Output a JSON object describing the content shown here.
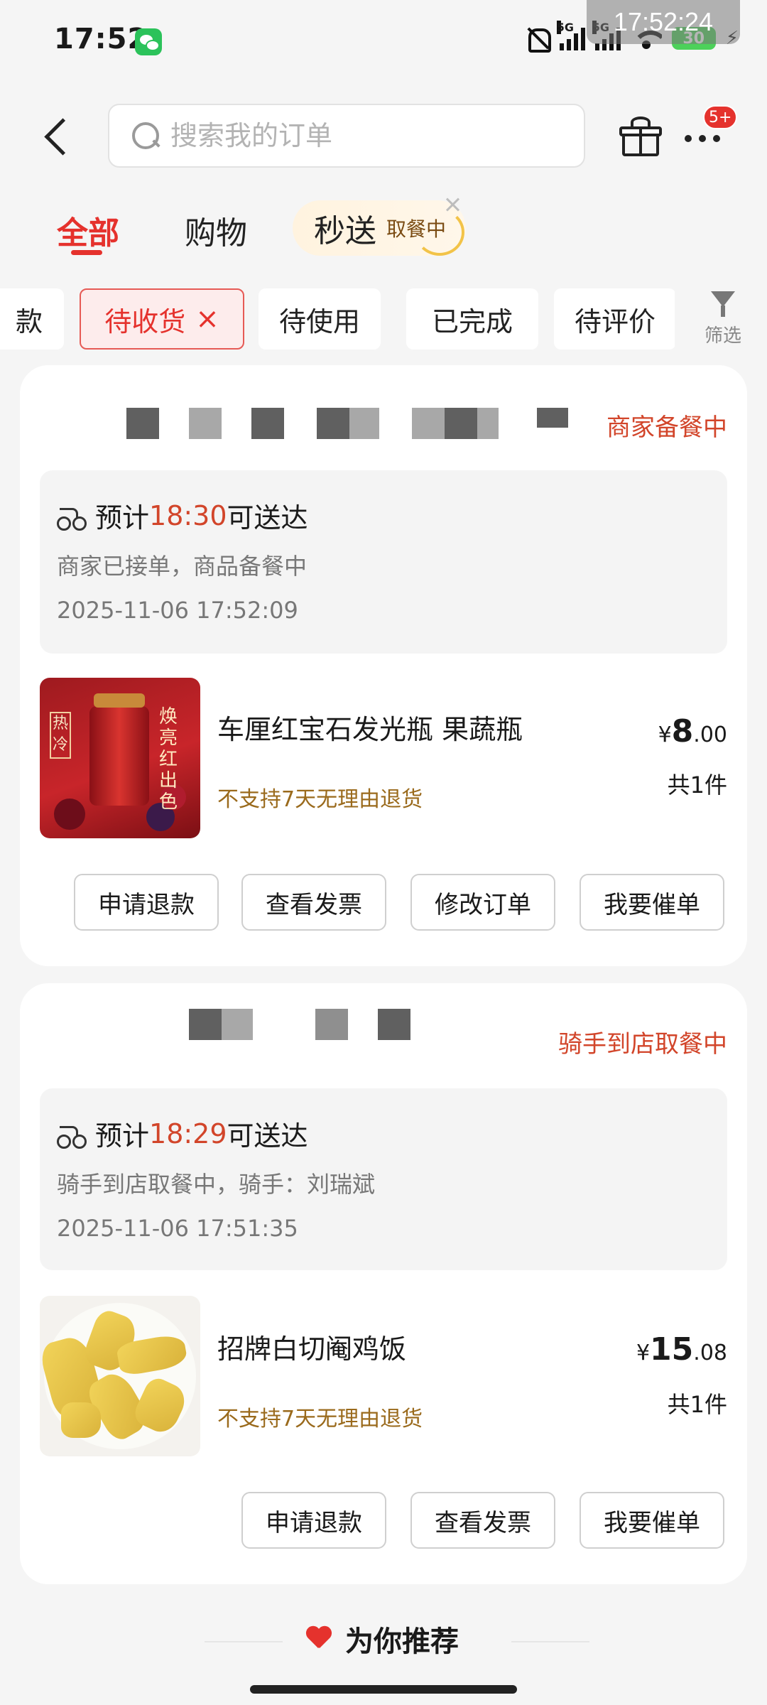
{
  "status_bar": {
    "time": "17:52",
    "battery": "30",
    "network_1": "5G",
    "network_2": "5G",
    "overlay_clock": "17:52:24"
  },
  "search": {
    "placeholder": "搜索我的订单"
  },
  "header": {
    "badge": "5+"
  },
  "tabs": {
    "all": "全部",
    "shopping": "购物",
    "instant": "秒送",
    "instant_pill": "取餐中"
  },
  "filter_chips": [
    {
      "label": "款"
    },
    {
      "label": "待收货",
      "close": "×"
    },
    {
      "label": "待使用"
    },
    {
      "label": "已完成"
    },
    {
      "label": "待评价"
    }
  ],
  "filter": {
    "label": "筛选"
  },
  "orders": [
    {
      "status": "商家备餐中",
      "eta_prefix": "预计",
      "eta_time": "18:30",
      "eta_suffix": "可送达",
      "detail": "商家已接单，商品备餐中",
      "timestamp": "2025-11-06 17:52:09",
      "product": {
        "name": "车厘红宝石发光瓶 果蔬瓶",
        "note": "不支持7天无理由退货",
        "price_symbol": "¥",
        "price_int": "8",
        "price_dec": ".00",
        "qty": "共1件",
        "img_tag": "热冷",
        "img_text": "焕亮红出色"
      },
      "buttons": [
        "申请退款",
        "查看发票",
        "修改订单",
        "我要催单"
      ]
    },
    {
      "status": "骑手到店取餐中",
      "eta_prefix": "预计",
      "eta_time": "18:29",
      "eta_suffix": "可送达",
      "detail": "骑手到店取餐中，骑手：刘瑞斌",
      "timestamp": "2025-11-06 17:51:35",
      "product": {
        "name": "招牌白切阉鸡饭",
        "note": "不支持7天无理由退货",
        "price_symbol": "¥",
        "price_int": "15",
        "price_dec": ".08",
        "qty": "共1件"
      },
      "buttons": [
        "申请退款",
        "查看发票",
        "我要催单"
      ]
    }
  ],
  "recommend": {
    "title": "为你推荐"
  },
  "colors": {
    "accent": "#e5322d",
    "status": "#d2452a",
    "note": "#9a6a1c"
  }
}
